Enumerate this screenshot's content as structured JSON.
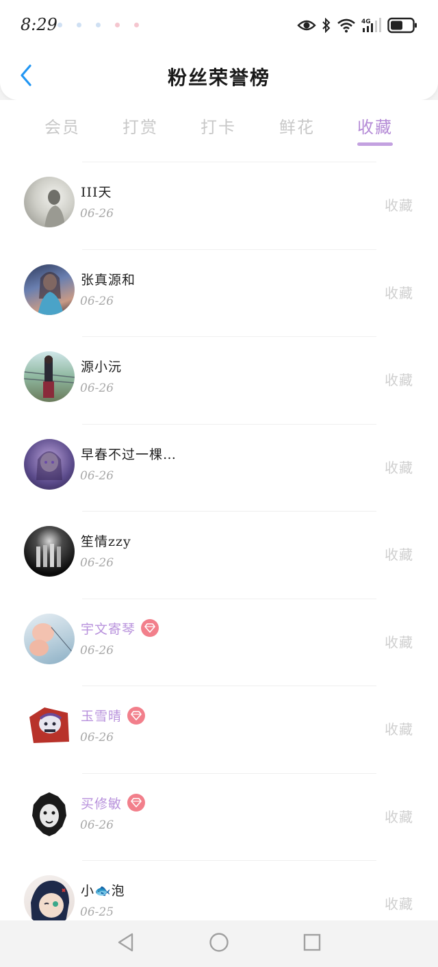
{
  "status_bar": {
    "time": "8:29",
    "network": "4G"
  },
  "header": {
    "title": "粉丝荣誉榜"
  },
  "tabs": [
    {
      "label": "会员",
      "active": false
    },
    {
      "label": "打赏",
      "active": false
    },
    {
      "label": "打卡",
      "active": false
    },
    {
      "label": "鲜花",
      "active": false
    },
    {
      "label": "收藏",
      "active": true
    }
  ],
  "colors": {
    "accent": "#b48ad6",
    "badge": "#f27f8b",
    "back_icon": "#2196f3"
  },
  "fans": [
    {
      "name": "III天",
      "date": "06-26",
      "action": "收藏",
      "vip": false
    },
    {
      "name": "张真源和",
      "date": "06-26",
      "action": "收藏",
      "vip": false
    },
    {
      "name": "源小沅",
      "date": "06-26",
      "action": "收藏",
      "vip": false
    },
    {
      "name": "早春不过一棵…",
      "date": "06-26",
      "action": "收藏",
      "vip": false
    },
    {
      "name": "笙情zzy",
      "date": "06-26",
      "action": "收藏",
      "vip": false
    },
    {
      "name": "宇文寄琴",
      "date": "06-26",
      "action": "收藏",
      "vip": true
    },
    {
      "name": "玉雪晴",
      "date": "06-26",
      "action": "收藏",
      "vip": true
    },
    {
      "name": "买修敏",
      "date": "06-26",
      "action": "收藏",
      "vip": true
    },
    {
      "name": "小🐟泡",
      "date": "06-25",
      "action": "收藏",
      "vip": false
    }
  ],
  "icons": {
    "back": "chevron-left-icon",
    "vip_badge": "diamond-icon",
    "system_nav": [
      "back-triangle-icon",
      "home-circle-icon",
      "recents-square-icon"
    ]
  }
}
